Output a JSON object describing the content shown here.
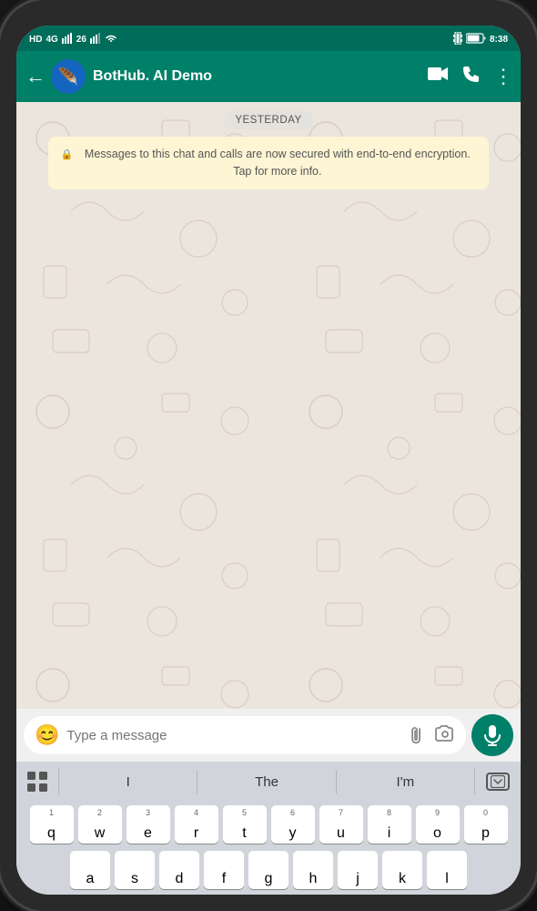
{
  "statusBar": {
    "left": "HD  4G  26",
    "time": "8:38",
    "signal": "▌▌▌",
    "wifi": "📶",
    "battery": "🔋"
  },
  "header": {
    "back_label": "←",
    "contact_name": "BotHub. AI Demo",
    "video_icon": "📹",
    "phone_icon": "📞",
    "more_icon": "⋮"
  },
  "chat": {
    "date_badge": "YESTERDAY",
    "security_notice": "Messages to this chat and calls are now secured with end-to-end encryption. Tap for more info."
  },
  "inputBar": {
    "placeholder": "Type a message",
    "emoji_label": "😊",
    "attach_label": "📎",
    "camera_label": "📷",
    "mic_label": "🎤"
  },
  "keyboard": {
    "suggestions": [
      "I",
      "The",
      "I'm"
    ],
    "rows": [
      [
        {
          "n": "1",
          "l": "q"
        },
        {
          "n": "2",
          "l": "w"
        },
        {
          "n": "3",
          "l": "e"
        },
        {
          "n": "4",
          "l": "r"
        },
        {
          "n": "5",
          "l": "t"
        },
        {
          "n": "6",
          "l": "y"
        },
        {
          "n": "7",
          "l": "u"
        },
        {
          "n": "8",
          "l": "i"
        },
        {
          "n": "9",
          "l": "o"
        },
        {
          "n": "0",
          "l": "p"
        }
      ]
    ]
  },
  "avatar": {
    "label": "BotHub logo"
  }
}
